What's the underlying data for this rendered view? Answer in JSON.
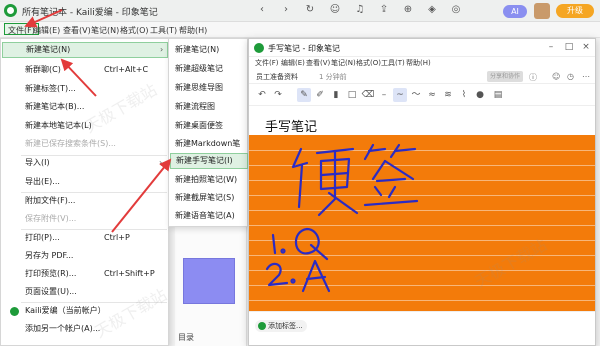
{
  "app": {
    "title": "所有笔记本 - Kaili爱编 - 印象笔记",
    "ai_label": "AI",
    "upgrade_label": "升级"
  },
  "menubar": {
    "file": "文件(F)",
    "edit": "编辑(E)",
    "view": "查看(V)",
    "note": "笔记(N)",
    "format": "格式(O)",
    "tools": "工具(T)",
    "help": "帮助(H)"
  },
  "file_menu": {
    "items": [
      {
        "label": "新建笔记(N)",
        "shortcut": "",
        "arrow": "›"
      },
      {
        "label": "新群聊(C)",
        "shortcut": "Ctrl+Alt+C",
        "arrow": ""
      },
      {
        "label": "新建标签(T)...",
        "shortcut": "",
        "arrow": ""
      },
      {
        "label": "新建笔记本(B)...",
        "shortcut": "",
        "arrow": ""
      },
      {
        "label": "新建本地笔记本(L)",
        "shortcut": "",
        "arrow": ""
      },
      {
        "label": "新建已保存搜索条件(S)...",
        "shortcut": "",
        "arrow": ""
      },
      {
        "label": "导入(I)",
        "shortcut": "",
        "arrow": "›"
      },
      {
        "label": "导出(E)...",
        "shortcut": "",
        "arrow": ""
      },
      {
        "label": "附加文件(F)...",
        "shortcut": "",
        "arrow": ""
      },
      {
        "label": "保存附件(V)...",
        "shortcut": "",
        "arrow": ""
      },
      {
        "label": "打印(P)...",
        "shortcut": "Ctrl+P",
        "arrow": ""
      },
      {
        "label": "另存为 PDF...",
        "shortcut": "",
        "arrow": ""
      },
      {
        "label": "打印预览(R)...",
        "shortcut": "Ctrl+Shift+P",
        "arrow": ""
      },
      {
        "label": "页面设置(U)...",
        "shortcut": "",
        "arrow": ""
      },
      {
        "label": "Kaili爱编（当前帐户）",
        "shortcut": "",
        "arrow": ""
      },
      {
        "label": "添加另一个帐户(A)...",
        "shortcut": "",
        "arrow": ""
      }
    ]
  },
  "sub_menu": {
    "items": [
      {
        "label": "新建笔记(N)"
      },
      {
        "label": "新建超级笔记"
      },
      {
        "label": "新建思维导图"
      },
      {
        "label": "新建流程图"
      },
      {
        "label": "新建桌面便签"
      },
      {
        "label": "新建Markdown笔"
      },
      {
        "label": "新建手写笔记(I)"
      },
      {
        "label": "新建拍照笔记(W)"
      },
      {
        "label": "新建截屏笔记(S)"
      },
      {
        "label": "新建语音笔记(A)"
      }
    ]
  },
  "note_window": {
    "title": "手写笔记 - 印象笔记",
    "menu": [
      "文件(F)",
      "编辑(E)",
      "查看(V)",
      "笔记(N)",
      "格式(O)",
      "工具(T)",
      "帮助(H)"
    ],
    "notebook": "员工准备资料",
    "time": "1 分钟前",
    "share_label": "分享和协作",
    "heading": "手写笔记",
    "tag_button": "添加标签..."
  },
  "background": {
    "list_text": "目录"
  },
  "watermark": "天极下载站"
}
